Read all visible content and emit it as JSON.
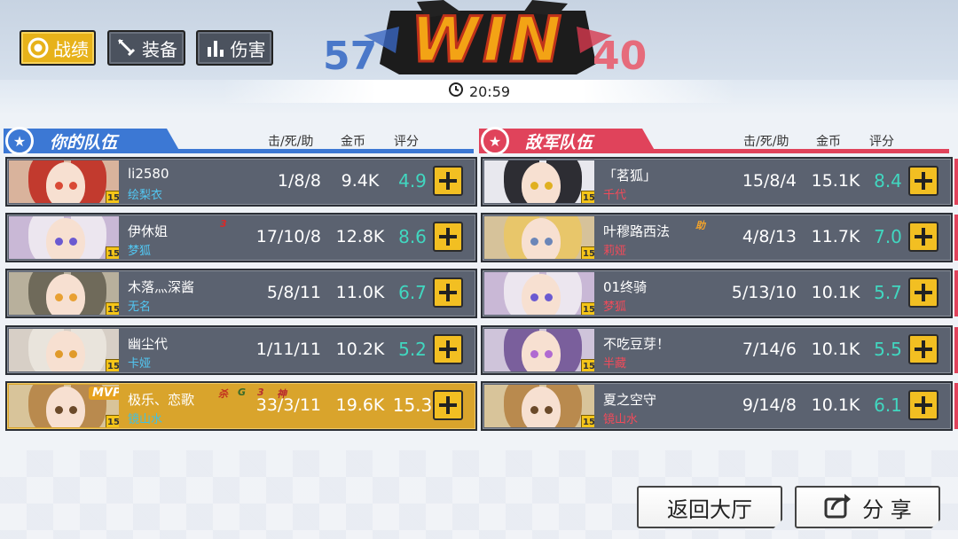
{
  "tabs": [
    {
      "label": "战绩",
      "icon": "target-icon",
      "active": true
    },
    {
      "label": "装备",
      "icon": "sword-icon",
      "active": false
    },
    {
      "label": "伤害",
      "icon": "bar-chart-icon",
      "active": false
    }
  ],
  "result": {
    "banner": "WIN",
    "ally_score": "57",
    "enemy_score": "40",
    "time": "20:59"
  },
  "columns": {
    "kda": "击/死/助",
    "gold": "金币",
    "rating": "评分"
  },
  "ally": {
    "title": "你的队伍",
    "players": [
      {
        "player": "li2580",
        "hero": "绘梨衣",
        "level": "15",
        "kda": "1/8/8",
        "gold": "9.4K",
        "rating": "4.9",
        "hair": "#c23a2e",
        "bg": "#d9b39c",
        "eye": "#d94a36"
      },
      {
        "player": "伊休姐",
        "hero": "梦狐",
        "level": "15",
        "kda": "17/10/8",
        "gold": "12.8K",
        "rating": "8.6",
        "hair": "#ece6ef",
        "bg": "#c9b8d6",
        "eye": "#6b5ad1",
        "badge": "3"
      },
      {
        "player": "木落灬深酱",
        "hero": "无名",
        "level": "15",
        "kda": "5/8/11",
        "gold": "11.0K",
        "rating": "6.7",
        "hair": "#6f6a5a",
        "bg": "#b8b09c",
        "eye": "#e8a032"
      },
      {
        "player": "幽尘代",
        "hero": "卡娅",
        "level": "15",
        "kda": "1/11/11",
        "gold": "10.2K",
        "rating": "5.2",
        "hair": "#e9e4dc",
        "bg": "#d7cfc6",
        "eye": "#e09a2a"
      },
      {
        "player": "极乐、恋歌",
        "hero": "镜山水",
        "level": "15",
        "kda": "33/3/11",
        "gold": "19.6K",
        "rating": "15.3",
        "hair": "#b98a4e",
        "bg": "#d8c49a",
        "eye": "#6b4a2a",
        "mvp": "MVP",
        "badges": [
          "杀",
          "G",
          "3",
          "神"
        ]
      }
    ]
  },
  "enemy": {
    "title": "敌军队伍",
    "players": [
      {
        "player": "「茗狐」",
        "hero": "千代",
        "level": "15",
        "kda": "15/8/4",
        "gold": "15.1K",
        "rating": "8.4",
        "hair": "#2d2d33",
        "bg": "#e8e8ee",
        "eye": "#e0b020"
      },
      {
        "player": "叶穆路西法",
        "hero": "莉娅",
        "level": "15",
        "kda": "4/8/13",
        "gold": "11.7K",
        "rating": "7.0",
        "hair": "#e8c66a",
        "bg": "#d6c29a",
        "eye": "#6b86b8",
        "badge": "助"
      },
      {
        "player": "01终骑",
        "hero": "梦狐",
        "level": "15",
        "kda": "5/13/10",
        "gold": "10.1K",
        "rating": "5.7",
        "hair": "#ece6ef",
        "bg": "#c9b8d6",
        "eye": "#6b5ad1"
      },
      {
        "player": "不吃豆芽！",
        "hero": "半藏",
        "level": "15",
        "kda": "7/14/6",
        "gold": "10.1K",
        "rating": "5.5",
        "hair": "#7a5f9c",
        "bg": "#cfc4da",
        "eye": "#b06ad1"
      },
      {
        "player": "夏之空守",
        "hero": "镜山水",
        "level": "15",
        "kda": "9/14/8",
        "gold": "10.1K",
        "rating": "6.1",
        "hair": "#b98a4e",
        "bg": "#d8c49a",
        "eye": "#6b4a2a"
      }
    ]
  },
  "footer": {
    "back_label": "返回大厅",
    "share_label": "分 享"
  },
  "colors": {
    "accent": "#e7b21a",
    "ally": "#3c78d4",
    "enemy": "#e0435b",
    "rating": "#41d7c0"
  }
}
